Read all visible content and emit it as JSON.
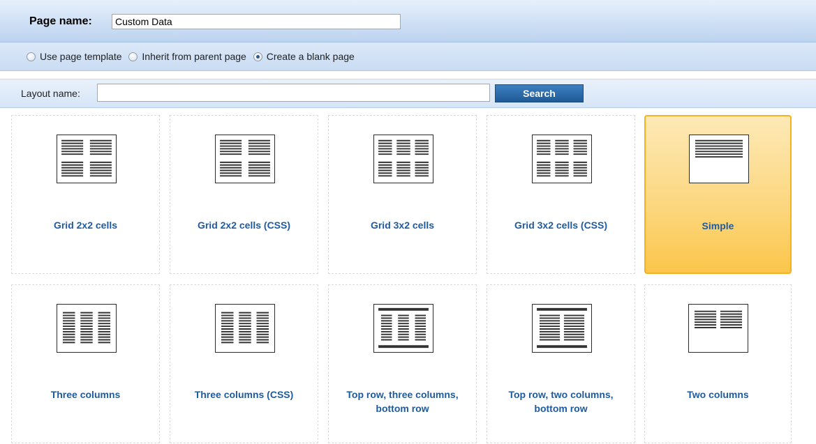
{
  "page_name": {
    "label": "Page name:",
    "value": "Custom Data"
  },
  "options": [
    {
      "label": "Use page template",
      "checked": false
    },
    {
      "label": "Inherit from parent page",
      "checked": false
    },
    {
      "label": "Create a blank page",
      "checked": true
    }
  ],
  "search": {
    "label": "Layout name:",
    "value": "",
    "button": "Search"
  },
  "layouts": [
    {
      "label": "Grid 2x2 cells",
      "icon": "grid-2x2-layout-icon",
      "selected": false
    },
    {
      "label": "Grid 2x2 cells (CSS)",
      "icon": "grid-2x2-layout-icon",
      "selected": false
    },
    {
      "label": "Grid 3x2 cells",
      "icon": "grid-3x2-layout-icon",
      "selected": false
    },
    {
      "label": "Grid 3x2 cells (CSS)",
      "icon": "grid-3x2-layout-icon",
      "selected": false
    },
    {
      "label": "Simple",
      "icon": "simple-layout-icon",
      "selected": true
    },
    {
      "label": "Three columns",
      "icon": "three-columns-layout-icon",
      "selected": false
    },
    {
      "label": "Three columns (CSS)",
      "icon": "three-columns-layout-icon",
      "selected": false
    },
    {
      "label": "Top row, three columns, bottom row",
      "icon": "top-three-bottom-layout-icon",
      "selected": false
    },
    {
      "label": "Top row, two columns, bottom row",
      "icon": "top-two-bottom-layout-icon",
      "selected": false
    },
    {
      "label": "Two columns",
      "icon": "two-columns-layout-icon",
      "selected": false
    }
  ],
  "colors": {
    "selected_accent": "#fbc64a",
    "link": "#1f5a9e",
    "button": "#2a6aa8"
  }
}
